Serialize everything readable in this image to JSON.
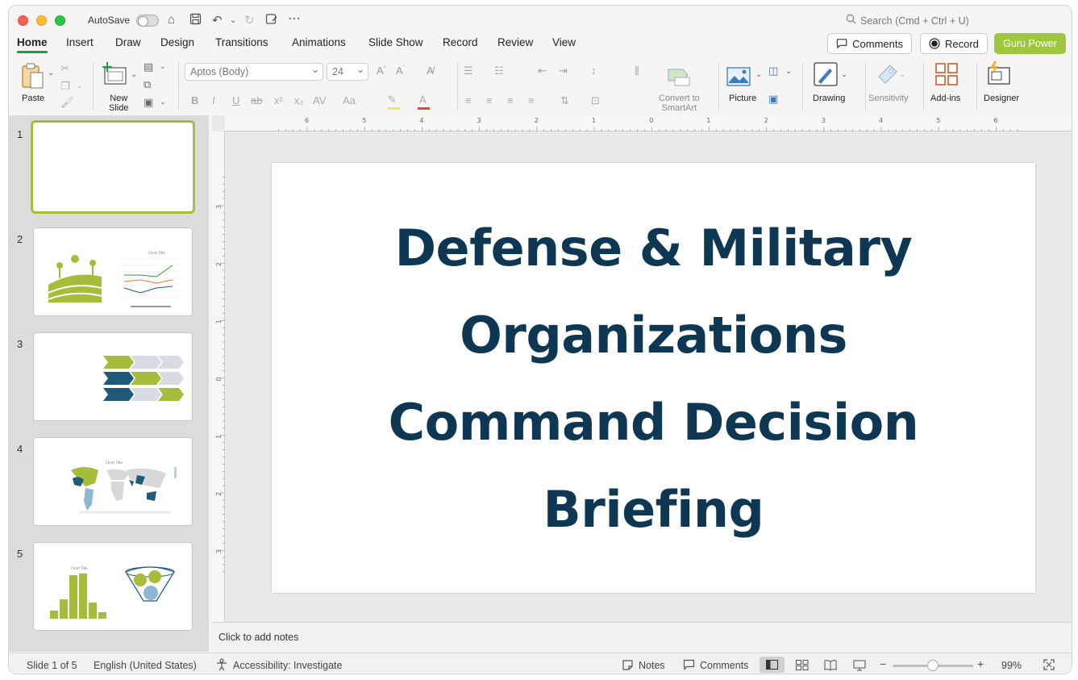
{
  "titlebar": {
    "autosave_label": "AutoSave",
    "search_placeholder": "Search (Cmd + Ctrl + U)"
  },
  "tabs": [
    "Home",
    "Insert",
    "Draw",
    "Design",
    "Transitions",
    "Animations",
    "Slide Show",
    "Record",
    "Review",
    "View"
  ],
  "right_buttons": {
    "comments": "Comments",
    "record": "Record",
    "guru": "Guru Power"
  },
  "ribbon": {
    "paste": "Paste",
    "new_slide_line1": "New",
    "new_slide_line2": "Slide",
    "font_name": "Aptos (Body)",
    "font_size": "24",
    "convert_line1": "Convert to",
    "convert_line2": "SmartArt",
    "picture": "Picture",
    "drawing": "Drawing",
    "sensitivity": "Sensitivity",
    "addins": "Add-ins",
    "designer": "Designer"
  },
  "ruler_h": [
    "6",
    "5",
    "4",
    "3",
    "2",
    "1",
    "0",
    "1",
    "2",
    "3",
    "4",
    "5",
    "6"
  ],
  "ruler_v": [
    "3",
    "2",
    "1",
    "0",
    "1",
    "2",
    "3"
  ],
  "thumbnails": [
    {
      "number": "1"
    },
    {
      "number": "2",
      "chart_title": "Chart Title"
    },
    {
      "number": "3"
    },
    {
      "number": "4",
      "chart_title": "Chart Title"
    },
    {
      "number": "5",
      "chart_title": "Chart Title"
    }
  ],
  "slide": {
    "title_lines": [
      "Defense & Military",
      "Organizations",
      "Command Decision",
      "Briefing"
    ]
  },
  "notes_placeholder": "Click to add notes",
  "status": {
    "slide_count": "Slide 1 of 5",
    "language": "English (United States)",
    "accessibility": "Accessibility: Investigate",
    "notes": "Notes",
    "comments": "Comments",
    "zoom": "99%",
    "zoom_level": 0.5
  },
  "colors": {
    "accent_green": "#9cc73e",
    "title_navy": "#0d3753",
    "tab_underline": "#1a9e4a"
  }
}
